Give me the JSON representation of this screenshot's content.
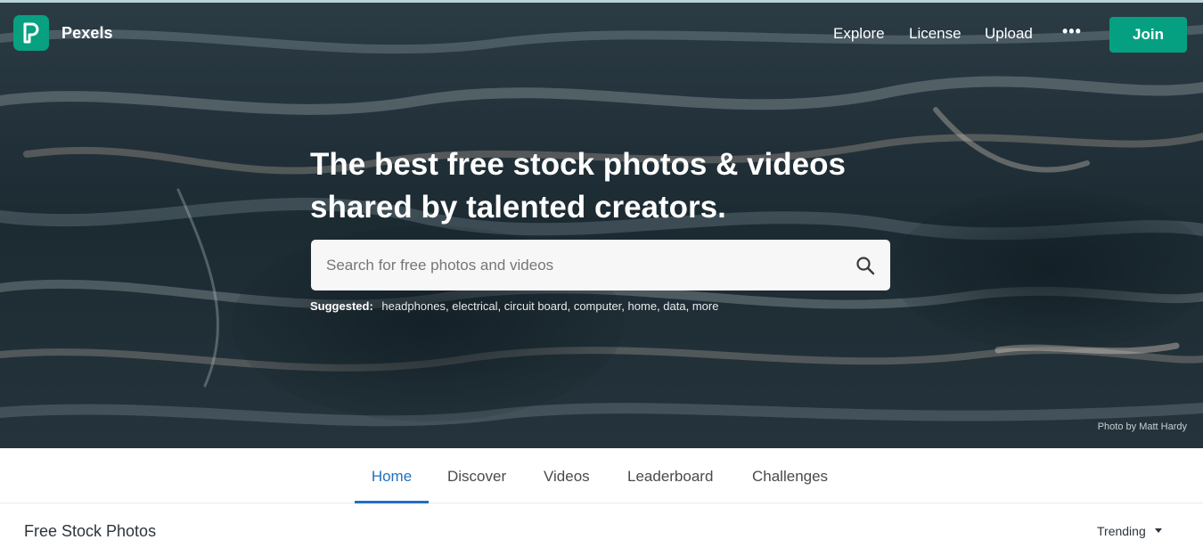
{
  "header": {
    "brand": "Pexels",
    "nav": {
      "explore": "Explore",
      "license": "License",
      "upload": "Upload",
      "more": "•••"
    },
    "join_label": "Join"
  },
  "hero": {
    "headline_line1": "The best free stock photos & videos",
    "headline_line2": "shared by talented creators.",
    "search": {
      "placeholder": "Search for free photos and videos",
      "value": ""
    },
    "suggested_label": "Suggested:",
    "suggested_items": [
      "headphones",
      "electrical",
      "circuit board",
      "computer",
      "home",
      "data",
      "more"
    ],
    "credit": "Photo by Matt Hardy"
  },
  "tabs": [
    {
      "label": "Home",
      "active": true
    },
    {
      "label": "Discover",
      "active": false
    },
    {
      "label": "Videos",
      "active": false
    },
    {
      "label": "Leaderboard",
      "active": false
    },
    {
      "label": "Challenges",
      "active": false
    }
  ],
  "section": {
    "title": "Free Stock Photos",
    "sort_value": "Trending"
  },
  "colors": {
    "brand_green": "#05a081",
    "active_tab": "#1f6fc5",
    "hero_dark": "#1d2b33"
  },
  "icons": {
    "logo": "pexels-logo-icon",
    "search": "search-icon",
    "more": "ellipsis-icon",
    "sort": "chevron-down-icon"
  }
}
